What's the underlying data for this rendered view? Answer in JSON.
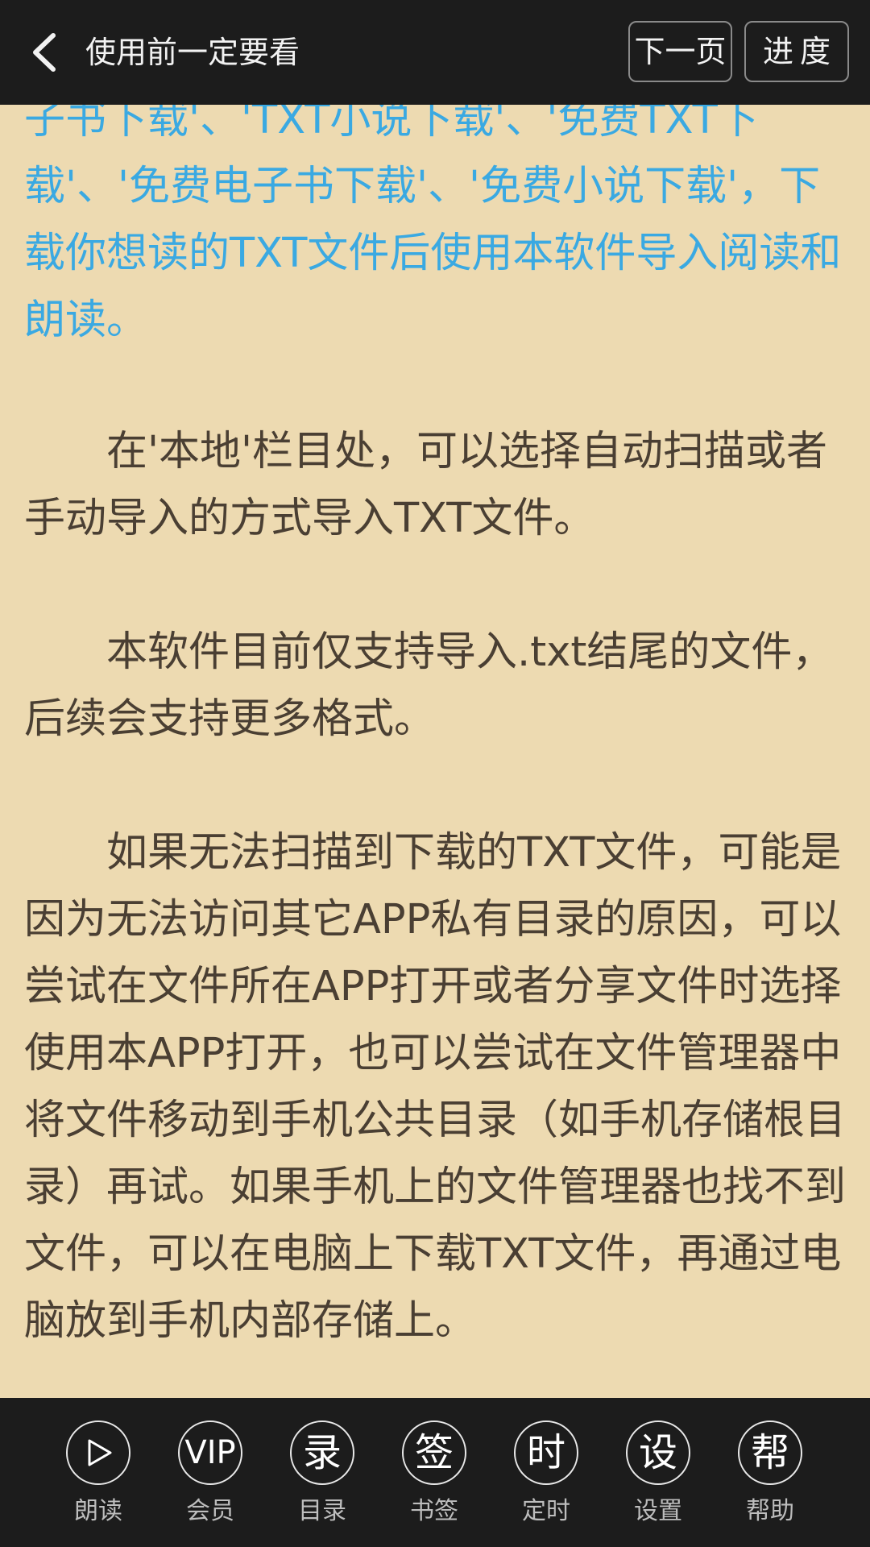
{
  "header": {
    "title": "使用前一定要看",
    "next_page_label": "下一页",
    "progress_label": "进度"
  },
  "content": {
    "link_paragraph": "子书下载'、'TXT小说下载'、'免费TXT下载'、'免费电子书下载'、'免费小说下载'，下载你想读的TXT文件后使用本软件导入阅读和朗读。",
    "paragraphs": [
      "　　在'本地'栏目处，可以选择自动扫描或者手动导入的方式导入TXT文件。",
      "　　本软件目前仅支持导入.txt结尾的文件，后续会支持更多格式。",
      "　　如果无法扫描到下载的TXT文件，可能是因为无法访问其它APP私有目录的原因，可以尝试在文件所在APP打开或者分享文件时选择使用本APP打开，也可以尝试在文件管理器中将文件移动到手机公共目录（如手机存储根目录）再试。如果手机上的文件管理器也找不到文件，可以在电脑上下载TXT文件，再通过电脑放到手机内部存储上。"
    ]
  },
  "toolbar": {
    "items": [
      {
        "icon_text": "",
        "icon": "play-icon",
        "label": "朗读"
      },
      {
        "icon_text": "VIP",
        "icon": "vip-icon",
        "label": "会员"
      },
      {
        "icon_text": "录",
        "icon": "catalog-icon",
        "label": "目录"
      },
      {
        "icon_text": "签",
        "icon": "bookmark-icon",
        "label": "书签"
      },
      {
        "icon_text": "时",
        "icon": "timer-icon",
        "label": "定时"
      },
      {
        "icon_text": "设",
        "icon": "settings-icon",
        "label": "设置"
      },
      {
        "icon_text": "帮",
        "icon": "help-icon",
        "label": "帮助"
      }
    ]
  },
  "colors": {
    "page_background": "#eddab1",
    "bar_background": "#1c1c1c",
    "link_text": "#3aa9e2",
    "body_text": "#4a3f33"
  }
}
